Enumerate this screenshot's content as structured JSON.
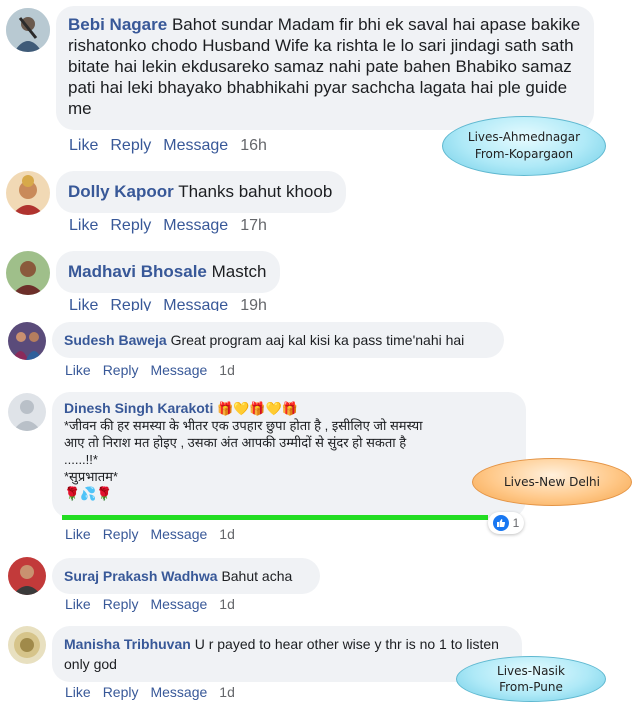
{
  "actions": {
    "like": "Like",
    "reply": "Reply",
    "message": "Message"
  },
  "comments": [
    {
      "author": "Bebi Nagare",
      "text": "Bahot sundar Madam fir bhi ek saval hai apase bakike rishatonko chodo Husband Wife ka rishta le lo sari jindagi sath sath bitate hai lekin ekdusareko samaz nahi pate bahen Bhabiko samaz pati hai leki bhayako bhabhikahi pyar sachcha lagata hai ple guide me",
      "time": "16h"
    },
    {
      "author": "Dolly Kapoor",
      "text": "Thanks bahut khoob",
      "time": "17h"
    },
    {
      "author": "Madhavi Bhosale",
      "text": "Mastch",
      "time": "19h"
    },
    {
      "author": "Sudesh Baweja",
      "text": "Great program aaj kal kisi ka pass time'nahi hai",
      "time": "1d"
    },
    {
      "author": "Dinesh Singh Karakoti",
      "text_lines": [
        "*जीवन की हर समस्या के भीतर एक उपहार छुपा होता है , इसीलिए जो समस्या",
        "आए तो निराश मत होइए , उसका अंत आपकी उम्मीदों से सुंदर हो सकता है",
        "......!!*",
        "*सुप्रभातम*"
      ],
      "emoji_line": "🌹💦🌹",
      "header_emoji": "🎁💛🎁💛🎁",
      "time": "1d",
      "reaction_count": "1"
    },
    {
      "author": "Suraj Prakash Wadhwa",
      "text": "Bahut acha",
      "time": "1d"
    },
    {
      "author": "Manisha Tribhuvan",
      "text": "U r payed to hear other wise y thr is no 1 to listen only god",
      "time": "1d"
    }
  ],
  "annotations": {
    "ahmednagar": {
      "line1": "Lives-Ahmednagar",
      "line2": "From-Kopargaon"
    },
    "delhi": {
      "line1": "Lives-New Delhi"
    },
    "nasik": {
      "line1": "Lives-Nasik",
      "line2": "From-Pune"
    }
  },
  "colors": {
    "name": "#385898",
    "bubble": "#f0f2f5",
    "meta": "#65676b",
    "highlight": "#22dd22",
    "reaction": "#1877f2"
  }
}
